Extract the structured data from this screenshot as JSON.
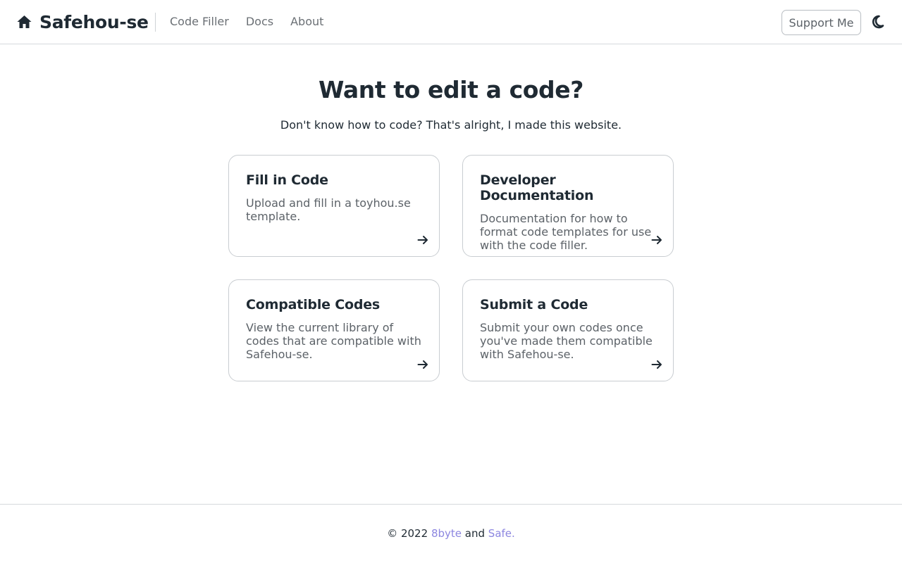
{
  "navbar": {
    "brand": "Safehou-se",
    "brand_icon": "home-icon",
    "links": [
      "Code Filler",
      "Docs",
      "About"
    ],
    "support_label": "Support Me",
    "theme_icon": "moon-icon"
  },
  "hero": {
    "title": "Want to edit a code?",
    "subtitle": "Don't know how to code? That's alright, I made this website."
  },
  "cards": [
    {
      "title": "Fill in Code",
      "text": "Upload and fill in a toyhou.se template.",
      "icon": "arrow-right-icon"
    },
    {
      "title": "Developer Documentation",
      "text": "Documentation for how to format code templates for use with the code filler.",
      "icon": "arrow-right-icon"
    },
    {
      "title": "Compatible Codes",
      "text": "View the current library of codes that are compatible with Safehou-se.",
      "icon": "arrow-right-icon"
    },
    {
      "title": "Submit a Code",
      "text": "Submit your own codes once you've made them compatible with Safehou-se.",
      "icon": "arrow-right-icon"
    }
  ],
  "footer": {
    "prefix": "© 2022",
    "author1": "8byte",
    "conj": "and",
    "author2": "Safe."
  },
  "colors": {
    "text": "#1f2a33",
    "muted": "#5c6268",
    "link": "#8c86e0",
    "border": "#c9cdd1"
  }
}
